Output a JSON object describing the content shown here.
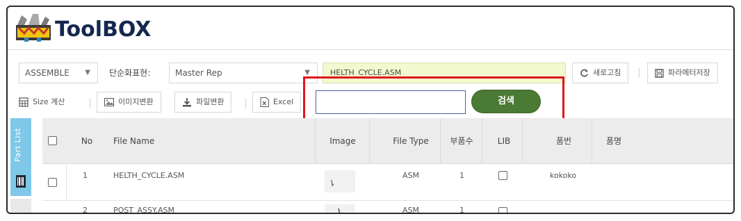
{
  "app": {
    "logo_text": "ToolBOX"
  },
  "toolbar": {
    "type_select": "ASSEMBLE",
    "simplify_label": "단순화표현:",
    "rep_select": "Master Rep",
    "path_value": "HELTH_CYCLE.ASM",
    "refresh_label": "새로고침",
    "save_params_label": "파라메터저장",
    "size_calc_label": "Size 계산",
    "image_convert_label": "이미지변환",
    "file_convert_label": "파일변환",
    "excel_label": "Excel",
    "search_value": "",
    "search_button": "검색"
  },
  "side_tab": {
    "label": "Part List"
  },
  "table": {
    "columns": [
      "No",
      "File Name",
      "Image",
      "File Type",
      "부품수",
      "LIB",
      "품번",
      "품명"
    ],
    "rows": [
      {
        "no": "1",
        "file_name": "HELTH_CYCLE.ASM",
        "file_type": "ASM",
        "parts": "1",
        "part_no": "kokoko",
        "part_name": ""
      },
      {
        "no": "2",
        "file_name": "POST_ASSY.ASM",
        "file_type": "ASM",
        "parts": "1",
        "part_no": "",
        "part_name": ""
      }
    ]
  },
  "colors": {
    "accent_green": "#4a7a33",
    "highlight_box": "#e0141e",
    "path_bg": "#f3f9cf",
    "side_tab": "#7fc8e8",
    "logo_navy": "#15284f"
  }
}
